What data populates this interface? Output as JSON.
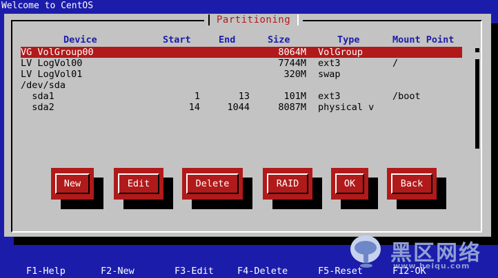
{
  "window": {
    "title": "Welcome to CentOS"
  },
  "dialog": {
    "title": "Partitioning",
    "columns": {
      "device": "Device",
      "start": "Start",
      "end": "End",
      "size": "Size",
      "type": "Type",
      "mount": "Mount Point"
    },
    "rows": [
      {
        "device": "VG VolGroup00",
        "start": "",
        "end": "",
        "size": "8064M",
        "type": "VolGroup",
        "mount": "",
        "selected": true
      },
      {
        "device": "LV LogVol00",
        "start": "",
        "end": "",
        "size": "7744M",
        "type": "ext3",
        "mount": "/"
      },
      {
        "device": "LV LogVol01",
        "start": "",
        "end": "",
        "size": "320M",
        "type": "swap",
        "mount": ""
      },
      {
        "device": "/dev/sda",
        "start": "",
        "end": "",
        "size": "",
        "type": "",
        "mount": ""
      },
      {
        "device": "  sda1",
        "start": "1",
        "end": "13",
        "size": "101M",
        "type": "ext3",
        "mount": "/boot"
      },
      {
        "device": "  sda2",
        "start": "14",
        "end": "1044",
        "size": "8087M",
        "type": "physical v",
        "mount": ""
      }
    ],
    "buttons": {
      "new": "New",
      "edit": "Edit",
      "delete": "Delete",
      "raid": "RAID",
      "ok": "OK",
      "back": "Back"
    }
  },
  "function_keys": {
    "f1": "F1-Help",
    "f2": "F2-New",
    "f3": "F3-Edit",
    "f4": "F4-Delete",
    "f5": "F5-Reset",
    "f12": "F12-OK"
  },
  "watermark": {
    "name": "黑区网络",
    "url": "www.heiqu.com"
  },
  "colors": {
    "background": "#1c1caa",
    "dialog": "#c3c3c3",
    "accent_red": "#b11a1a",
    "text_white": "#ffffff",
    "header_blue": "#1c1caa"
  }
}
